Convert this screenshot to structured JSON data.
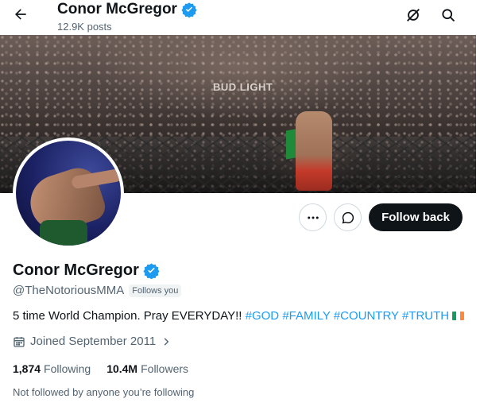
{
  "header": {
    "name": "Conor McGregor",
    "posts": "12.9K posts"
  },
  "banner": {
    "sign_text": "BUD LIGHT"
  },
  "actions": {
    "follow_back_label": "Follow back"
  },
  "profile": {
    "name": "Conor McGregor",
    "handle": "@TheNotoriousMMA",
    "follows_you": "Follows you",
    "bio_text": "5 time World Champion. Pray EVERYDAY!!",
    "hashtags": [
      "#GOD",
      "#FAMILY",
      "#COUNTRY",
      "#TRUTH"
    ],
    "joined": "Joined September 2011",
    "following_count": "1,874",
    "following_label": "Following",
    "followers_count": "10.4M",
    "followers_label": "Followers",
    "not_followed": "Not followed by anyone you’re following"
  },
  "colors": {
    "verified_blue": "#1d9bf0",
    "text_primary": "#0f1419",
    "text_secondary": "#536471",
    "button_dark": "#0f1419"
  },
  "icons": [
    "back-arrow-icon",
    "verified-badge-icon",
    "notifications-off-icon",
    "search-icon",
    "more-dots-icon",
    "message-icon",
    "calendar-icon",
    "chevron-right-icon",
    "ireland-flag-icon"
  ]
}
